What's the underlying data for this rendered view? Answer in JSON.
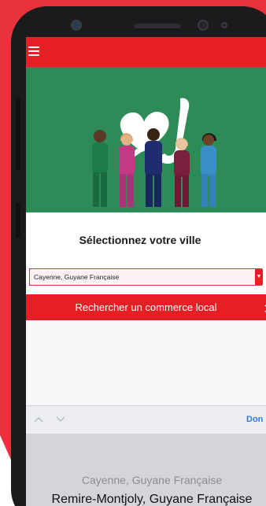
{
  "menu": {
    "icon": "hamburger-menu-icon"
  },
  "hero": {
    "image": "illustration of healthcare workers with heart-shaped speech bubble"
  },
  "page": {
    "title": "Sélectionnez votre ville"
  },
  "city_select": {
    "selected_value": "Cayenne, Guyane Française"
  },
  "search": {
    "label": "Rechercher un commerce local"
  },
  "keyboard_accessory": {
    "done_label": "Don"
  },
  "picker": {
    "items": [
      "Cayenne, Guyane Française",
      "Remire-Montjoly, Guyane Française"
    ]
  },
  "colors": {
    "brand_red": "#e51f23",
    "hero_green": "#2e8b57",
    "background_red": "#e8323c",
    "done_blue": "#2b7de0"
  }
}
